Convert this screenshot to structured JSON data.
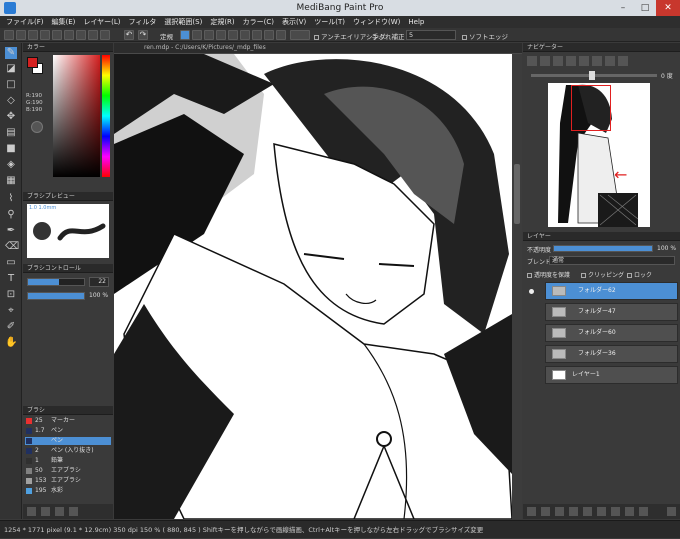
{
  "window": {
    "title": "MediBang Paint Pro"
  },
  "menu": [
    "ファイル(F)",
    "編集(E)",
    "レイヤー(L)",
    "フィルタ",
    "選択範囲(S)",
    "定規(R)",
    "カラー(C)",
    "表示(V)",
    "ツール(T)",
    "ウィンドウ(W)",
    "Help"
  ],
  "toolbar": {
    "snap_label": "定規",
    "antialias_label": "アンチエイリアシング",
    "stabilizer_label": "手ぶれ補正",
    "stabilizer_value": "5",
    "soft_edge_label": "ソフトエッジ"
  },
  "document": {
    "tab_title": "ren.mdp - C:/Users/K/Pictures/_mdp_files"
  },
  "color_panel": {
    "title": "カラー",
    "readouts": [
      "R:190",
      "G:190",
      "B:190"
    ],
    "fg": "#d42020",
    "bg": "#ffffff"
  },
  "brush_preview": {
    "title": "ブラシプレビュー",
    "size_label": "1.0 1.0mm"
  },
  "brush_control": {
    "title": "ブラシコントロール",
    "size_value": "22",
    "opacity_value": "100 %",
    "size_fill": 0.55,
    "opacity_fill": 1.0
  },
  "brush_panel": {
    "title": "ブラシ",
    "items": [
      {
        "size": "25",
        "name": "マーカー",
        "color": "#e83030"
      },
      {
        "size": "1.7",
        "name": "ペン",
        "color": "#203060"
      },
      {
        "size": "",
        "name": "ペン",
        "color": "#203060",
        "selected": true
      },
      {
        "size": "2",
        "name": "ペン (入り抜き)",
        "color": "#203060"
      },
      {
        "size": "1",
        "name": "鉛筆",
        "color": "#303030"
      },
      {
        "size": "50",
        "name": "エアブラシ",
        "color": "#808080"
      },
      {
        "size": "153",
        "name": "エアブラシ",
        "color": "#a0a0a0"
      },
      {
        "size": "195",
        "name": "水彩",
        "color": "#4fa0e0"
      }
    ]
  },
  "navigator": {
    "title": "ナビゲーター",
    "rotation": "0 度"
  },
  "layer_panel": {
    "title": "レイヤー",
    "opacity_label": "不透明度",
    "opacity_value": "100 %",
    "opacity_fill": 1.0,
    "blend_label": "ブレンド",
    "blend_value": "通常",
    "protect_label": "透明度を保護",
    "clipping_label": "クリッピング",
    "lock_label": "ロック",
    "layers": [
      {
        "name": "フォルダー62",
        "type": "folder",
        "selected": true,
        "visible": true
      },
      {
        "name": "フォルダー47",
        "type": "folder",
        "selected": false,
        "visible": false
      },
      {
        "name": "フォルダー60",
        "type": "folder",
        "selected": false,
        "visible": false
      },
      {
        "name": "フォルダー36",
        "type": "folder",
        "selected": false,
        "visible": false
      },
      {
        "name": "レイヤー1",
        "type": "raster",
        "selected": false,
        "visible": false
      }
    ]
  },
  "status": {
    "text": "1254 * 1771 pixel   (9.1 * 12.9cm)   350 dpi   150 %   ( 880, 845 )   Shiftキーを押しながらで画線描画、Ctrl+Altキーを押しながら左右ドラッグでブラシサイズ変更"
  }
}
